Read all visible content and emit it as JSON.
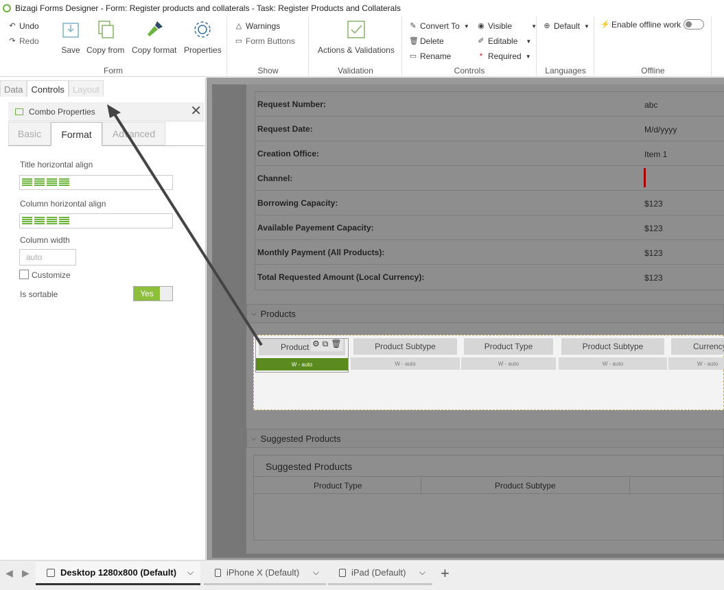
{
  "window": {
    "title": "Bizagi Forms Designer  - Form: Register products and collaterals - Task:  Register Products and Collaterals"
  },
  "ribbon": {
    "undo": "Undo",
    "redo": "Redo",
    "save": "Save",
    "copy_from": "Copy from",
    "copy_format": "Copy format",
    "properties": "Properties",
    "group_form": "Form",
    "warnings": "Warnings",
    "form_buttons": "Form Buttons",
    "group_show": "Show",
    "actions_validations": "Actions & Validations",
    "group_validation": "Validation",
    "convert_to": "Convert To",
    "delete": "Delete",
    "rename": "Rename",
    "visible": "Visible",
    "editable": "Editable",
    "required": "Required",
    "group_controls": "Controls",
    "default": "Default",
    "group_languages": "Languages",
    "enable_offline": "Enable offline work",
    "group_offline": "Offline"
  },
  "panel": {
    "tabs": [
      "Data",
      "Controls",
      "Layout"
    ],
    "title": "Combo Properties",
    "subtabs": [
      "Basic",
      "Format",
      "Advanced"
    ],
    "title_align_label": "Title horizontal align",
    "column_align_label": "Column horizontal align",
    "column_width_label": "Column width",
    "column_width_placeholder": "auto",
    "customize_label": "Customize",
    "is_sortable_label": "Is sortable",
    "is_sortable_value": "Yes"
  },
  "form": {
    "rows": [
      {
        "label": "Request Number:",
        "value": "abc"
      },
      {
        "label": "Request Date:",
        "value": "M/d/yyyy"
      },
      {
        "label": "Creation Office:",
        "value": "Item 1"
      },
      {
        "label": "Channel:",
        "value": ""
      },
      {
        "label": "Borrowing Capacity:",
        "value": "$123"
      },
      {
        "label": "Available Payement Capacity:",
        "value": "$123"
      },
      {
        "label": "Monthly Payment (All Products):",
        "value": "$123"
      },
      {
        "label": "Total Requested Amount (Local Currency):",
        "value": "$123"
      }
    ],
    "products_section": "Products",
    "product_columns": [
      {
        "title": "Product",
        "width": "W - auto"
      },
      {
        "title": "Product Subtype",
        "width": "W - auto"
      },
      {
        "title": "Product Type",
        "width": "W - auto"
      },
      {
        "title": "Product Subtype",
        "width": "W - auto"
      },
      {
        "title": "Currency",
        "width": "W - auto"
      }
    ],
    "suggested_section": "Suggested Products",
    "suggested_title": "Suggested Products",
    "suggested_columns": [
      "Product Type",
      "Product Subtype"
    ]
  },
  "devices": {
    "tabs": [
      {
        "label": "Desktop 1280x800 (Default)"
      },
      {
        "label": "iPhone X (Default)"
      },
      {
        "label": "iPad (Default)"
      }
    ],
    "add": "+"
  },
  "colors": {
    "accent": "#6db33f",
    "selected": "#5b8a1f",
    "required": "#cc0000"
  }
}
